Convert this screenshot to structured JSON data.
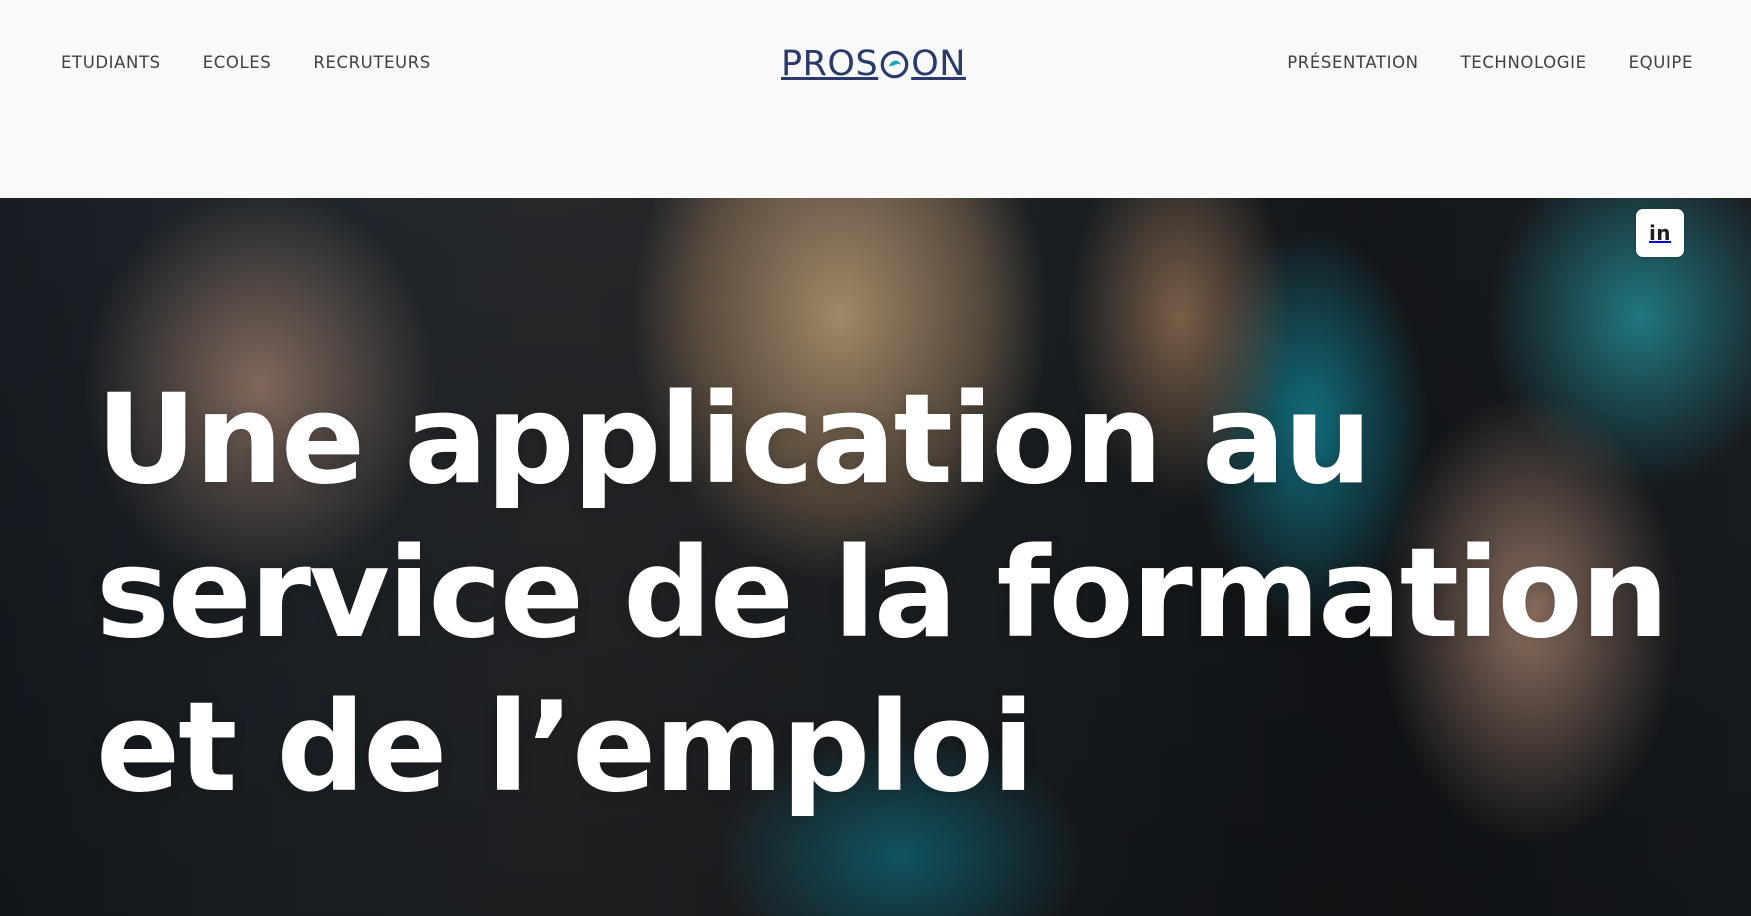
{
  "nav_left": {
    "items": [
      "ETUDIANTS",
      "ECOLES",
      "RECRUTEURS"
    ]
  },
  "logo": {
    "text_before": "PROS",
    "text_after": "ON"
  },
  "nav_right": {
    "items": [
      "PRÉSENTATION",
      "TECHNOLOGIE",
      "EQUIPE"
    ]
  },
  "hero": {
    "headline_line_1": "Une application au",
    "headline_line_2": "service de la formation",
    "headline_line_3": "et de l’emploi"
  },
  "social": {
    "icon": "linkedin-icon",
    "label": "in"
  },
  "colors": {
    "logo": "#2a3b6b",
    "logo_accent": "#1aa6b8",
    "nav_text": "#3f3f3f",
    "headline": "#ffffff",
    "background": "#f9f9f9"
  }
}
